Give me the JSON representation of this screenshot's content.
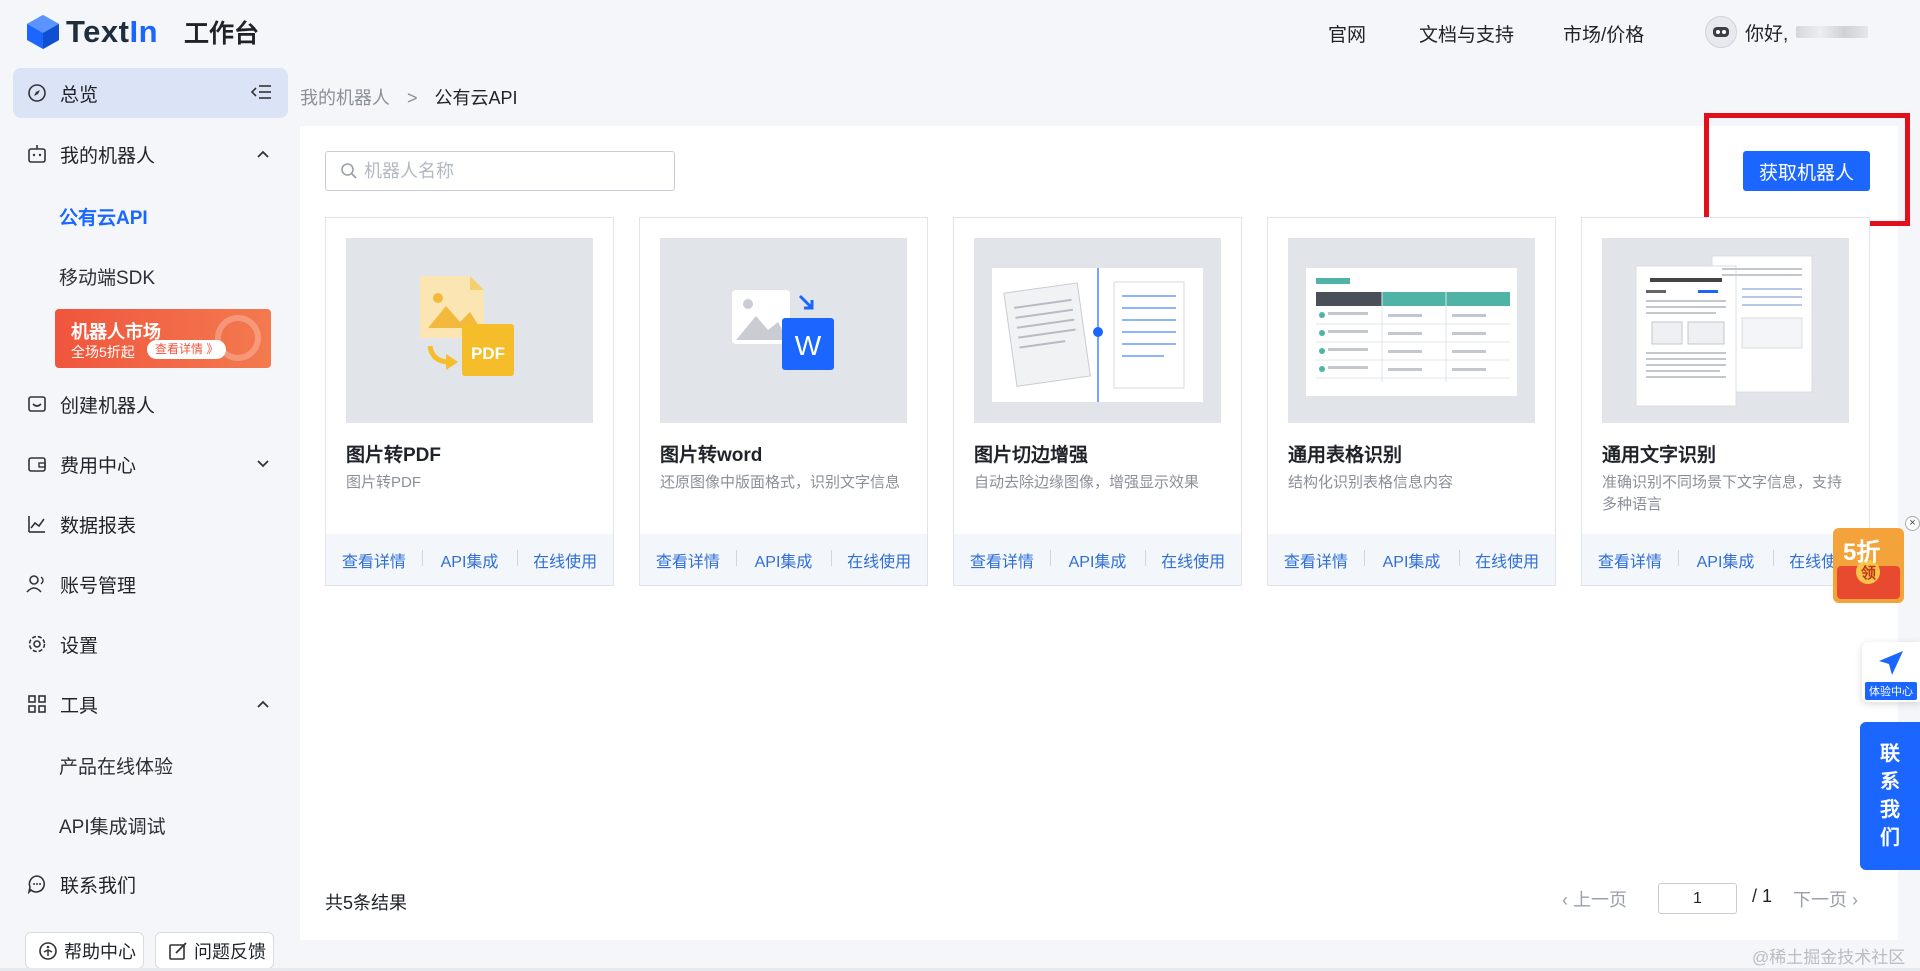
{
  "header": {
    "logo_text": "TextIn",
    "logo_sub": "工作台",
    "nav": [
      "官网",
      "文档与支持",
      "市场/价格"
    ],
    "greeting": "你好,"
  },
  "sidebar": {
    "overview": "总览",
    "my_robots": "我的机器人",
    "sub_public_api": "公有云API",
    "sub_mobile_sdk": "移动端SDK",
    "promo_title": "机器人市场",
    "promo_sub": "全场5折起",
    "promo_pill": "查看详情 》",
    "create_robot": "创建机器人",
    "billing": "费用中心",
    "reports": "数据报表",
    "accounts": "账号管理",
    "settings": "设置",
    "tools": "工具",
    "sub_online_trial": "产品在线体验",
    "sub_api_debug": "API集成调试",
    "contact": "联系我们",
    "help_center": "帮助中心",
    "feedback": "问题反馈"
  },
  "breadcrumb": {
    "parent": "我的机器人",
    "separator": ">",
    "current": "公有云API"
  },
  "search": {
    "placeholder": "机器人名称"
  },
  "actions": {
    "get_robot": "获取机器人"
  },
  "cards": [
    {
      "title": "图片转PDF",
      "desc": "图片转PDF",
      "actions": [
        "查看详情",
        "API集成",
        "在线使用"
      ]
    },
    {
      "title": "图片转word",
      "desc": "还原图像中版面格式，识别文字信息",
      "actions": [
        "查看详情",
        "API集成",
        "在线使用"
      ]
    },
    {
      "title": "图片切边增强",
      "desc": "自动去除边缘图像，增强显示效果",
      "actions": [
        "查看详情",
        "API集成",
        "在线使用"
      ]
    },
    {
      "title": "通用表格识别",
      "desc": "结构化识别表格信息内容",
      "actions": [
        "查看详情",
        "API集成",
        "在线使用"
      ]
    },
    {
      "title": "通用文字识别",
      "desc": "准确识别不同场景下文字信息，支持多种语言",
      "actions": [
        "查看详情",
        "API集成",
        "在线使用"
      ]
    }
  ],
  "pagination": {
    "total": "共5条结果",
    "prev": "上一页",
    "page": "1",
    "of": "/  1",
    "next": "下一页"
  },
  "floating": {
    "discount": "5折",
    "discount_claim": "领",
    "experience": "体验中心",
    "contact": [
      "联",
      "系",
      "我",
      "们"
    ]
  },
  "watermark": "@稀土掘金技术社区",
  "colors": {
    "primary": "#1a66ff",
    "highlight": "#e3101c",
    "promo": "#f0553d"
  }
}
